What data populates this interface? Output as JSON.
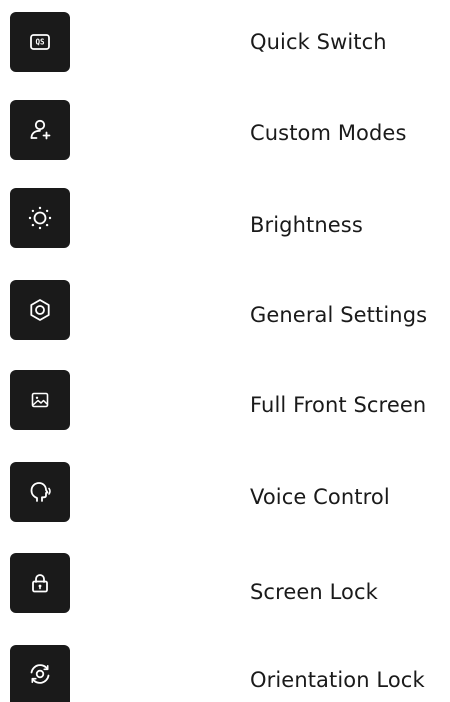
{
  "colors": {
    "tile_background": "#1a1a1a",
    "icon_color": "#ffffff",
    "label_color": "#1a1a1a",
    "page_background": "#ffffff"
  },
  "items": [
    {
      "label": "Quick Switch",
      "icon": "quick-switch-icon",
      "icon_text": "QS"
    },
    {
      "label": "Custom Modes",
      "icon": "person-add-icon"
    },
    {
      "label": "Brightness",
      "icon": "brightness-icon"
    },
    {
      "label": "General Settings",
      "icon": "hexagon-settings-icon"
    },
    {
      "label": "Full Front Screen",
      "icon": "image-icon"
    },
    {
      "label": "Voice Control",
      "icon": "voice-control-icon"
    },
    {
      "label": "Screen Lock",
      "icon": "lock-icon"
    },
    {
      "label": "Orientation Lock",
      "icon": "rotation-lock-icon"
    }
  ]
}
